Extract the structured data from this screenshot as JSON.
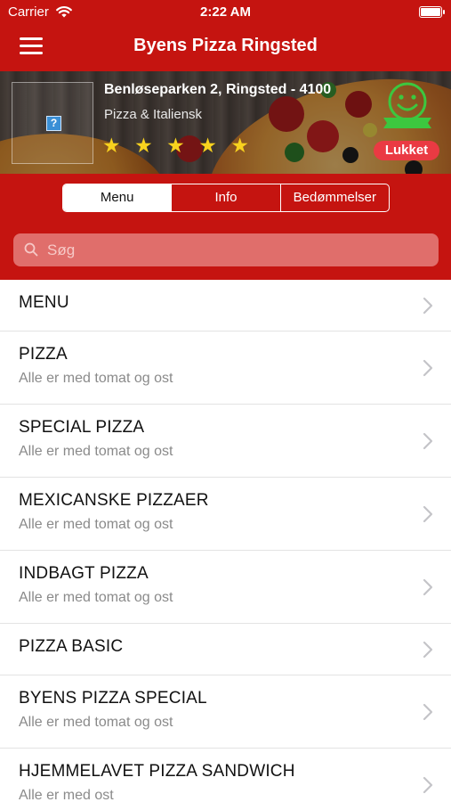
{
  "status_bar": {
    "carrier": "Carrier",
    "time": "2:22 AM"
  },
  "nav": {
    "title": "Byens Pizza Ringsted"
  },
  "restaurant": {
    "address": "Benløseparken 2, Ringsted - 4100",
    "cuisine": "Pizza & Italiensk",
    "rating_stars": 5,
    "status_badge": "Lukket",
    "logo_placeholder_glyph": "?"
  },
  "tabs": [
    {
      "label": "Menu",
      "active": true
    },
    {
      "label": "Info",
      "active": false
    },
    {
      "label": "Bedømmelser",
      "active": false
    }
  ],
  "search": {
    "placeholder": "Søg"
  },
  "menu_items": [
    {
      "title": "MENU",
      "subtitle": ""
    },
    {
      "title": "PIZZA",
      "subtitle": "Alle er med tomat og ost"
    },
    {
      "title": "SPECIAL PIZZA",
      "subtitle": "Alle er med tomat og ost"
    },
    {
      "title": "MEXICANSKE PIZZAER",
      "subtitle": "Alle er med tomat og ost"
    },
    {
      "title": "INDBAGT PIZZA",
      "subtitle": "Alle er med tomat og ost"
    },
    {
      "title": "PIZZA BASIC",
      "subtitle": ""
    },
    {
      "title": "BYENS PIZZA SPECIAL",
      "subtitle": "Alle er med tomat og ost"
    },
    {
      "title": "HJEMMELAVET PIZZA SANDWICH",
      "subtitle": "Alle er med ost"
    }
  ],
  "colors": {
    "brand_red": "#c51410",
    "search_field": "#e06e6b",
    "badge_red": "#ea3a43",
    "star_yellow": "#f8d21e",
    "smiley_green": "#3cc73f"
  },
  "icons": {
    "menu": "hamburger-icon",
    "wifi": "wifi-icon",
    "battery": "battery-icon",
    "search": "search-icon",
    "row_disclosure": "chevron-right-icon",
    "hygiene_badge": "smiley-icon",
    "rating": "star-icon"
  }
}
